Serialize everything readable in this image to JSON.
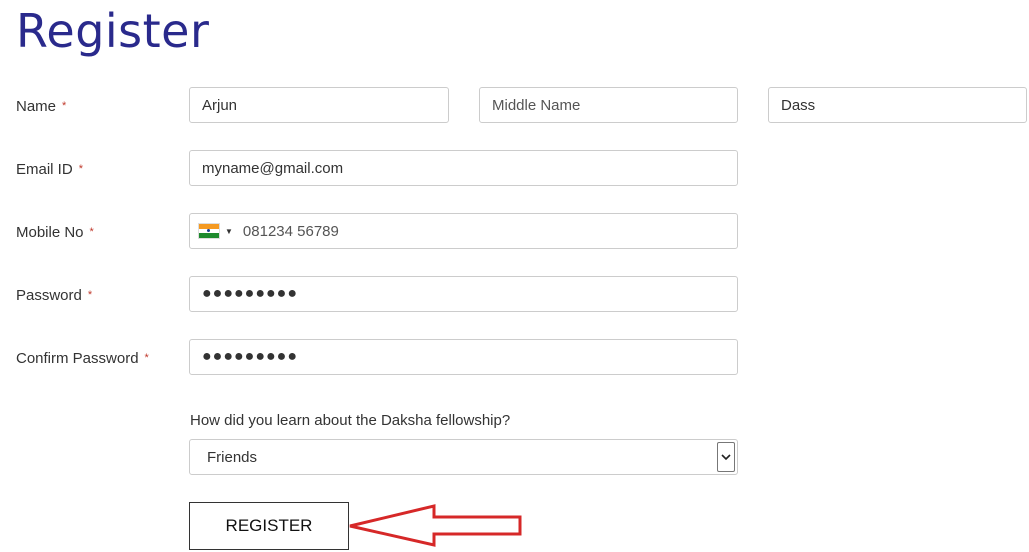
{
  "page": {
    "title": "Register"
  },
  "form": {
    "name": {
      "label": "Name",
      "required_mark": "*",
      "first": "Arjun",
      "middle_placeholder": "Middle Name",
      "last": "Dass"
    },
    "email": {
      "label": "Email ID",
      "required_mark": "*",
      "value": "myname@gmail.com"
    },
    "mobile": {
      "label": "Mobile No",
      "required_mark": "*",
      "value": "081234 56789",
      "country_flag": "india-flag"
    },
    "password": {
      "label": "Password",
      "required_mark": "*",
      "value": "●●●●●●●●●"
    },
    "confirm_password": {
      "label": "Confirm Password",
      "required_mark": "*",
      "value": "●●●●●●●●●"
    },
    "source": {
      "question": "How did you learn about the Daksha fellowship?",
      "selected": "Friends"
    },
    "submit": {
      "label": "REGISTER"
    }
  },
  "annotation": {
    "arrow_color": "#d62828"
  }
}
